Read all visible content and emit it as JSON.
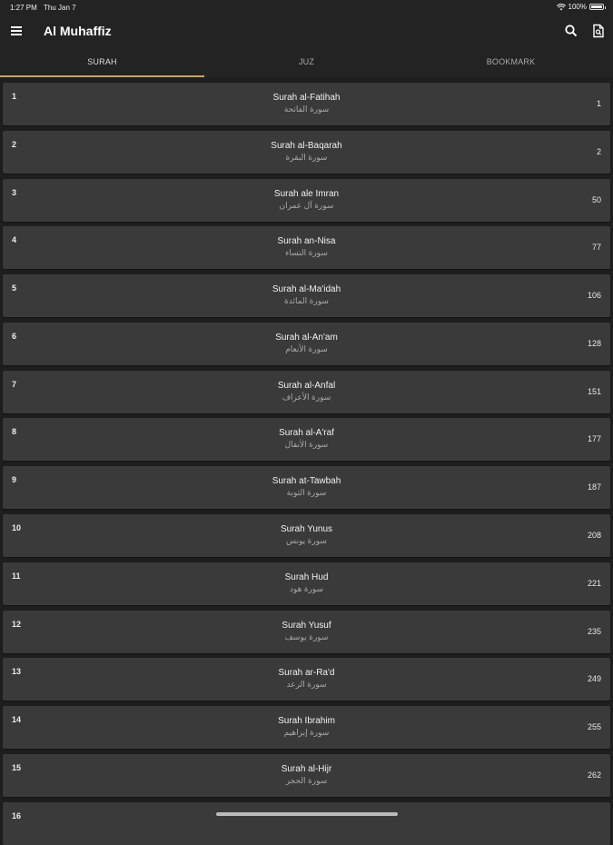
{
  "status_bar": {
    "time": "1:27 PM",
    "date": "Thu Jan 7",
    "battery": "100%"
  },
  "app_bar": {
    "title": "Al Muhaffiz"
  },
  "tabs": [
    {
      "label": "SURAH",
      "active": true
    },
    {
      "label": "JUZ",
      "active": false
    },
    {
      "label": "BOOKMARK",
      "active": false
    }
  ],
  "colors": {
    "accent": "#c9a66b",
    "background": "#1e1e1e",
    "row": "#3a3a3a"
  },
  "surahs": [
    {
      "num": "1",
      "name": "Surah al-Fatihah",
      "arabic": "سورة الفاتحة",
      "page": "1"
    },
    {
      "num": "2",
      "name": "Surah al-Baqarah",
      "arabic": "سورة البقرة",
      "page": "2"
    },
    {
      "num": "3",
      "name": "Surah ale Imran",
      "arabic": "سورة آل عمران",
      "page": "50"
    },
    {
      "num": "4",
      "name": "Surah an-Nisa",
      "arabic": "سورة النساء",
      "page": "77"
    },
    {
      "num": "5",
      "name": "Surah al-Ma'idah",
      "arabic": "سورة المائدة",
      "page": "106"
    },
    {
      "num": "6",
      "name": "Surah al-An'am",
      "arabic": "سورة الأنعام",
      "page": "128"
    },
    {
      "num": "7",
      "name": "Surah al-Anfal",
      "arabic": "سورة الأعراف",
      "page": "151"
    },
    {
      "num": "8",
      "name": "Surah al-A'raf",
      "arabic": "سورة الأنفال",
      "page": "177"
    },
    {
      "num": "9",
      "name": "Surah at-Tawbah",
      "arabic": "سورة التوبة",
      "page": "187"
    },
    {
      "num": "10",
      "name": "Surah Yunus",
      "arabic": "سورة يونس",
      "page": "208"
    },
    {
      "num": "11",
      "name": "Surah Hud",
      "arabic": "سورة هود",
      "page": "221"
    },
    {
      "num": "12",
      "name": "Surah Yusuf",
      "arabic": "سورة يوسف",
      "page": "235"
    },
    {
      "num": "13",
      "name": "Surah ar-Ra'd",
      "arabic": "سورة الرعد",
      "page": "249"
    },
    {
      "num": "14",
      "name": "Surah Ibrahim",
      "arabic": "سورة إبراهيم",
      "page": "255"
    },
    {
      "num": "15",
      "name": "Surah al-Hijr",
      "arabic": "سورة الحجر",
      "page": "262"
    },
    {
      "num": "16",
      "name": "",
      "arabic": "",
      "page": ""
    }
  ]
}
